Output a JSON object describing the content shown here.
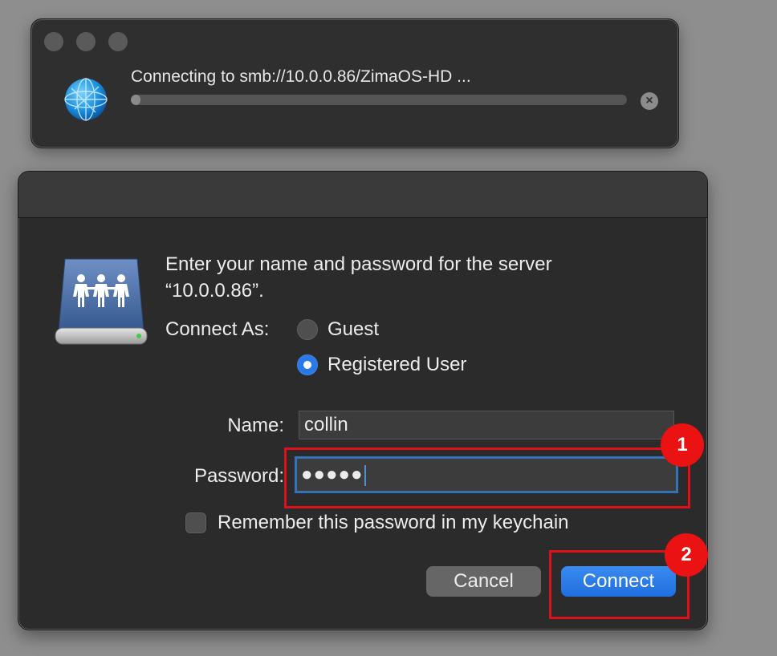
{
  "connecting_window": {
    "status_text": "Connecting to smb://10.0.0.86/ZimaOS-HD ...",
    "progress_fraction": 0.02,
    "stop_icon": "x-circle-icon",
    "app_icon": "network-globe-icon"
  },
  "auth_dialog": {
    "icon": "shared-server-icon",
    "prompt": "Enter your name and password for the server “10.0.0.86”.",
    "connect_as_label": "Connect As:",
    "options": [
      {
        "label": "Guest",
        "selected": false
      },
      {
        "label": "Registered User",
        "selected": true
      }
    ],
    "name_label": "Name:",
    "name_value": "collin",
    "password_label": "Password:",
    "password_masked": "●●●●●",
    "remember_label": "Remember this password in my keychain",
    "remember_checked": false,
    "cancel_label": "Cancel",
    "connect_label": "Connect"
  },
  "annotations": [
    {
      "number": "1",
      "target": "password-field"
    },
    {
      "number": "2",
      "target": "connect-button"
    }
  ],
  "colors": {
    "accent": "#2a79e6",
    "highlight": "#e0101a",
    "badge": "#ea1212"
  }
}
